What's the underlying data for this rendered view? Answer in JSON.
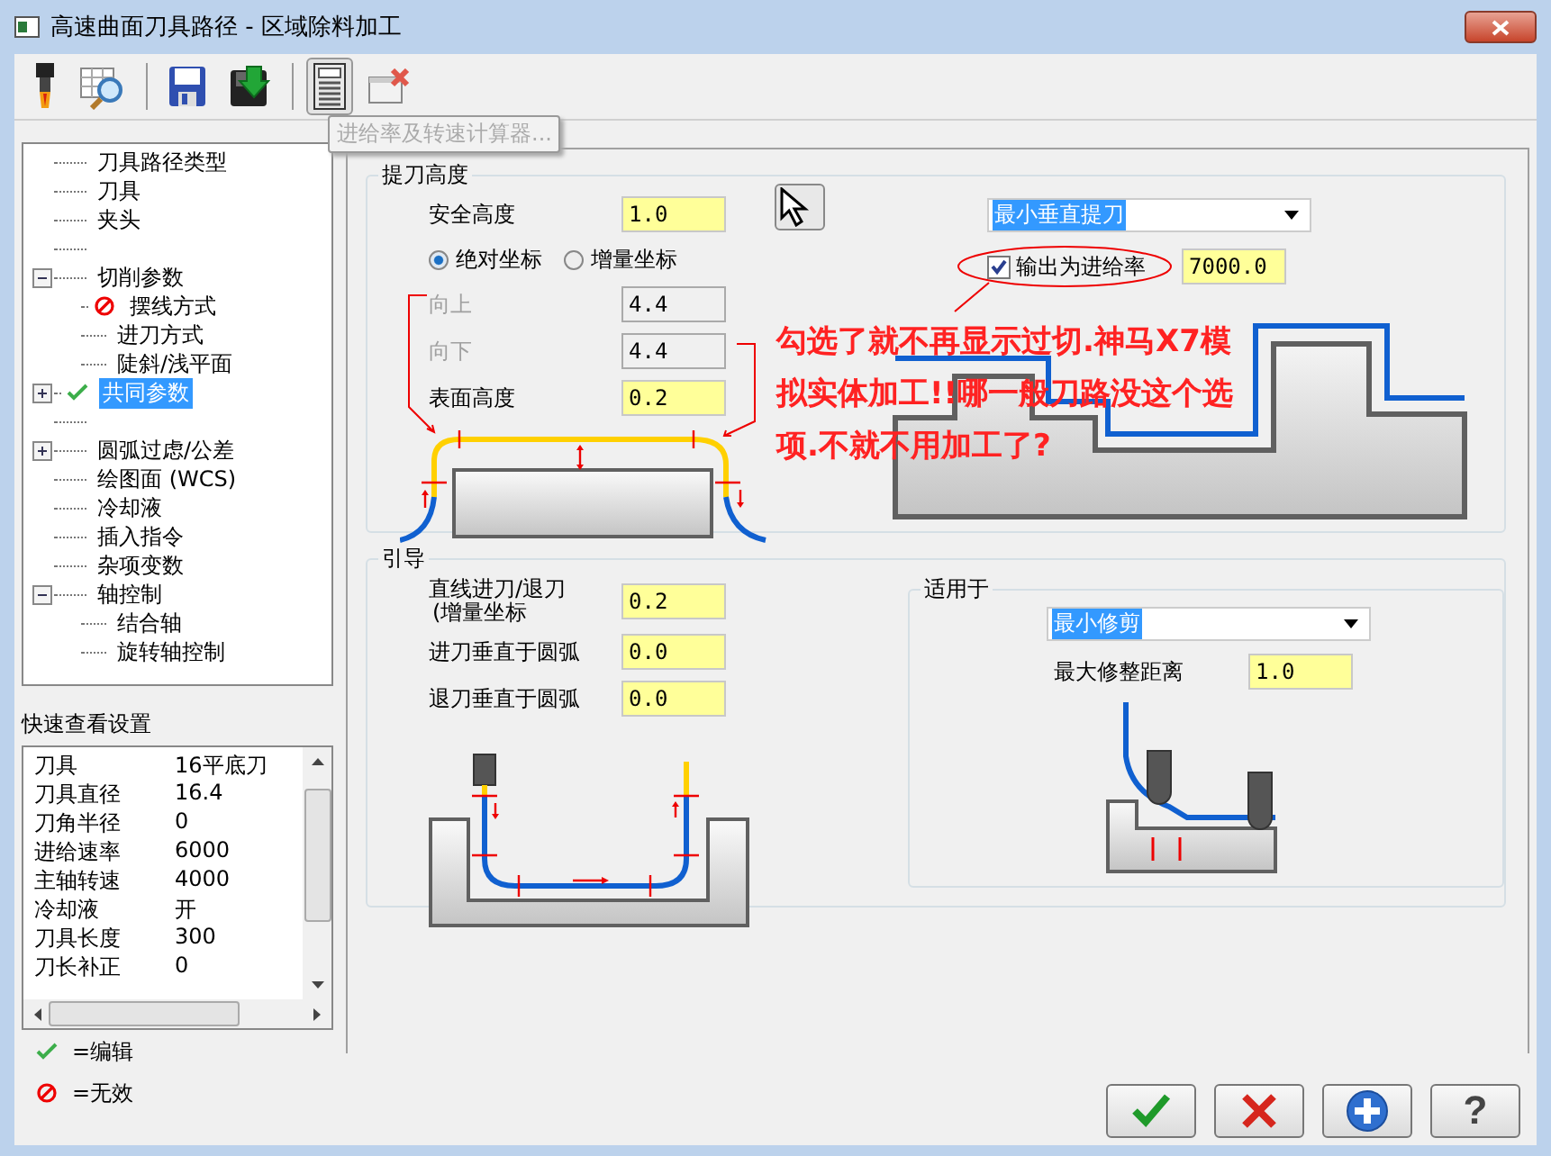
{
  "window": {
    "title": "高速曲面刀具路径 - 区域除料加工"
  },
  "toolbar": [
    {
      "kind": "tool",
      "pressed": false
    },
    {
      "kind": "table-search",
      "pressed": false
    },
    {
      "kind": "save",
      "pressed": false
    },
    {
      "kind": "save-load",
      "pressed": false
    },
    {
      "kind": "calculator",
      "pressed": true
    },
    {
      "kind": "window-delete",
      "pressed": false
    }
  ],
  "tooltip": {
    "text": "进给率及转速计算器..."
  },
  "tree": [
    {
      "label": "刀具路径类型",
      "selected": false,
      "edited": false,
      "invalid": false
    },
    {
      "label": "刀具",
      "selected": false,
      "edited": false,
      "invalid": false
    },
    {
      "label": "夹头",
      "selected": false,
      "edited": false,
      "invalid": false
    },
    {
      "selected": false,
      "edited": false,
      "invalid": false
    },
    {
      "label": "切削参数",
      "selected": false,
      "edited": false,
      "invalid": false,
      "expanded": true,
      "children": [
        {
          "label": "摆线方式",
          "selected": false,
          "edited": false,
          "invalid": true
        },
        {
          "label": "进刀方式",
          "selected": false,
          "edited": false,
          "invalid": false
        },
        {
          "label": "陡斜/浅平面",
          "selected": false,
          "edited": false,
          "invalid": false
        }
      ]
    },
    {
      "label": "共同参数",
      "selected": true,
      "edited": true,
      "invalid": false,
      "expanded": false
    },
    {
      "selected": false,
      "edited": false,
      "invalid": false
    },
    {
      "label": "圆弧过虑/公差",
      "selected": false,
      "edited": false,
      "invalid": false,
      "expanded": false
    },
    {
      "label": "绘图面 (WCS)",
      "selected": false,
      "edited": false,
      "invalid": false
    },
    {
      "label": "冷却液",
      "selected": false,
      "edited": false,
      "invalid": false
    },
    {
      "label": "插入指令",
      "selected": false,
      "edited": false,
      "invalid": false
    },
    {
      "label": "杂项变数",
      "selected": false,
      "edited": false,
      "invalid": false
    },
    {
      "label": "轴控制",
      "selected": false,
      "edited": false,
      "invalid": false,
      "expanded": true,
      "children": [
        {
          "label": "结合轴",
          "selected": false,
          "edited": false,
          "invalid": false
        },
        {
          "label": "旋转轴控制",
          "selected": false,
          "edited": false,
          "invalid": false
        }
      ]
    }
  ],
  "quick_view": {
    "title": "快速查看设置",
    "rows": [
      {
        "name": "刀具",
        "value": "16平底刀"
      },
      {
        "name": "刀具直径",
        "value": "16.4"
      },
      {
        "name": "刀角半径",
        "value": "0"
      },
      {
        "name": "进给速率",
        "value": "6000"
      },
      {
        "name": "主轴转速",
        "value": "4000"
      },
      {
        "name": "冷却液",
        "value": "开"
      },
      {
        "name": "刀具长度",
        "value": "300"
      },
      {
        "name": "刀长补正",
        "value": "0"
      }
    ]
  },
  "legend": [
    {
      "kind": "edited",
      "text": "=编辑"
    },
    {
      "kind": "invalid",
      "text": "=无效"
    }
  ],
  "retract": {
    "title": "提刀高度",
    "clearance": {
      "label": "安全高度",
      "value": "1.0"
    },
    "coords": [
      {
        "label": "绝对坐标",
        "selected": true
      },
      {
        "label": "增量坐标",
        "selected": false
      }
    ],
    "fields": [
      {
        "label": "向上",
        "value": "4.4",
        "disabled": true
      },
      {
        "label": "向下",
        "value": "4.4",
        "disabled": true
      },
      {
        "label": "表面高度",
        "value": "0.2",
        "disabled": false
      }
    ],
    "mode": {
      "value": "最小垂直提刀"
    },
    "feed_output": {
      "label": "输出为进给率",
      "checked": true,
      "value": "7000.0"
    },
    "annotation": [
      "勾选了就不再显示过切.神马X7模",
      "拟实体加工!!哪一般刀路没这个选",
      "项.不就不用加工了?"
    ]
  },
  "lead": {
    "title": "引导",
    "fields": [
      {
        "label": "直线进刀/退刀",
        "sublabel": "(增量坐标",
        "value": "0.2"
      },
      {
        "label": "进刀垂直于圆弧",
        "value": "0.0"
      },
      {
        "label": "退刀垂直于圆弧",
        "value": "0.0"
      }
    ],
    "apply": {
      "title": "适用于",
      "mode": {
        "value": "最小修剪"
      },
      "field": {
        "label": "最大修整距离",
        "value": "1.0"
      }
    }
  },
  "buttons": [
    {
      "kind": "ok"
    },
    {
      "kind": "cancel"
    },
    {
      "kind": "add"
    },
    {
      "kind": "help",
      "glyph": "?"
    }
  ]
}
